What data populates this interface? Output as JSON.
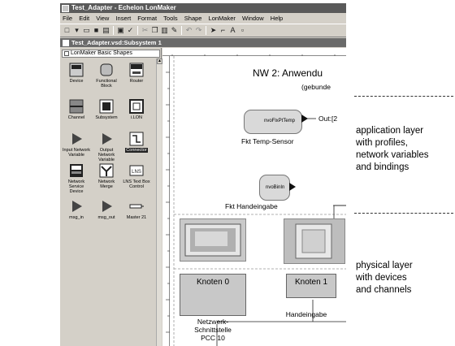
{
  "window": {
    "title": "Test_Adapter - Echelon LonMaker",
    "menu": [
      "File",
      "Edit",
      "View",
      "Insert",
      "Format",
      "Tools",
      "Shape",
      "LonMaker",
      "Window",
      "Help"
    ],
    "document_title": "Test_Adapter.vsd:Subsystem 1"
  },
  "stencil": {
    "title": "LonMaker Basic Shapes",
    "shapes": [
      {
        "label": "Device",
        "icon": "device-icon"
      },
      {
        "label": "Functional Block",
        "icon": "functional-block-icon"
      },
      {
        "label": "Router",
        "icon": "router-icon"
      },
      {
        "label": "Channel",
        "icon": "channel-icon"
      },
      {
        "label": "Subsystem",
        "icon": "subsystem-icon"
      },
      {
        "label": "i.LON",
        "icon": "ilon-icon"
      },
      {
        "label": "Input Network Variable",
        "icon": "input-nv-icon"
      },
      {
        "label": "Output Network Variable",
        "icon": "output-nv-icon"
      },
      {
        "label": "Connector",
        "icon": "connector-icon"
      },
      {
        "label": "Network Service Device",
        "icon": "nsd-icon"
      },
      {
        "label": "Network Merge",
        "icon": "network-merge-icon"
      },
      {
        "label": "LNS Text Box Control",
        "icon": "lns-textbox-icon"
      },
      {
        "label": "msg_in",
        "icon": "msg-in-icon"
      },
      {
        "label": "msg_out",
        "icon": "msg-out-icon"
      },
      {
        "label": "Master 21",
        "icon": "master21-icon"
      }
    ]
  },
  "canvas": {
    "title": "NW 2: Anwendu",
    "subtitle": "(gebunde",
    "fb1": {
      "nv": "nvoFlxPtTemp",
      "output": "Out:[2",
      "label": "Fkt Temp-Sensor"
    },
    "fb2": {
      "nv": "nvoBinIn",
      "label": "Fkt Handeingabe"
    },
    "node1": {
      "title": "Knoten 0",
      "label_line1": "Netzwerk-",
      "label_line2": "Schnittstelle",
      "label_line3": "PCC 10"
    },
    "node2": {
      "title": "Knoten 1",
      "label": "Handeingabe"
    }
  },
  "annotations": {
    "application": [
      "application layer",
      "with profiles,",
      "network variables",
      "and bindings"
    ],
    "physical": [
      "physical layer",
      "with devices",
      "and channels"
    ]
  }
}
